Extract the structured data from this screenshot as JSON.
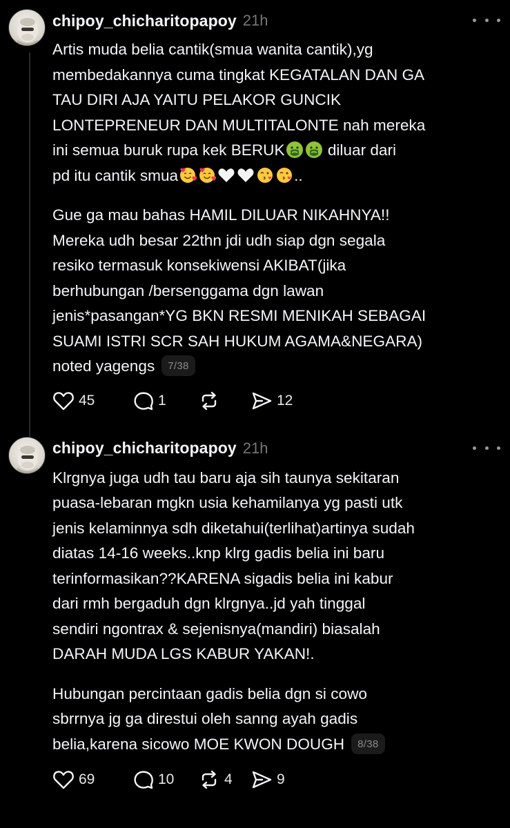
{
  "posts": [
    {
      "username": "chipoy_chicharitopapoy",
      "time": "21h",
      "paragraphs": [
        {
          "lines": [
            "Artis muda belia cantik(smua wanita cantik),yg",
            "membedakannya cuma tingkat KEGATALAN DAN GA",
            "TAU DIRI AJA YAITU PELAKOR GUNCIK",
            "LONTEPRENEUR DAN MULTITALONTE nah mereka",
            "ini semua buruk rupa kek BERUK",
            "diluar dari",
            "pd itu cantik smua",
            ".."
          ]
        },
        {
          "lines": [
            "Gue ga mau bahas HAMIL DILUAR NIKAHNYA!!",
            "Mereka udh besar 22thn jdi udh siap dgn segala",
            "resiko termasuk konsekiwensi AKIBAT(jika",
            "berhubungan /bersenggama dgn lawan",
            "jenis*pasangan*YG BKN RESMI MENIKAH SEBAGAI",
            "SUAMI ISTRI SCR SAH HUKUM AGAMA&NEGARA)",
            "noted yagengs"
          ]
        }
      ],
      "page_indicator": "7/38",
      "counts": {
        "likes": "45",
        "replies": "1",
        "shares": "12"
      }
    },
    {
      "username": "chipoy_chicharitopapoy",
      "time": "21h",
      "paragraphs": [
        {
          "lines": [
            "Klrgnya juga udh tau baru aja sih taunya sekitaran",
            "puasa-lebaran mgkn usia kehamilanya yg pasti utk",
            "jenis kelaminnya sdh diketahui(terlihat)artinya sudah",
            "diatas 14-16 weeks..knp klrg gadis belia ini baru",
            "terinformasikan??KARENA sigadis belia ini kabur",
            "dari rmh bergaduh dgn klrgnya..jd yah tinggal",
            "sendiri ngontrax & sejenisnya(mandiri) biasalah",
            "DARAH MUDA LGS KABUR YAKAN!."
          ]
        },
        {
          "lines": [
            "Hubungan percintaan gadis belia dgn si cowo",
            "sbrrnya jg ga direstui oleh sanng ayah gadis",
            "belia,karena sicowo MOE KWON DOUGH"
          ]
        }
      ],
      "page_indicator": "8/38",
      "counts": {
        "likes": "69",
        "replies": "10",
        "reposts": "4",
        "shares": "9"
      }
    }
  ],
  "emoji_names": {
    "nauseated": "nauseated-face-emoji",
    "hearts": "smiling-face-with-hearts-emoji",
    "white_heart": "white-heart-emoji",
    "kiss": "face-blowing-kiss-emoji"
  },
  "colors": {
    "background": "#000000",
    "text": "#f3f5f7",
    "muted": "#777777",
    "icon": "#f3f5f7"
  }
}
